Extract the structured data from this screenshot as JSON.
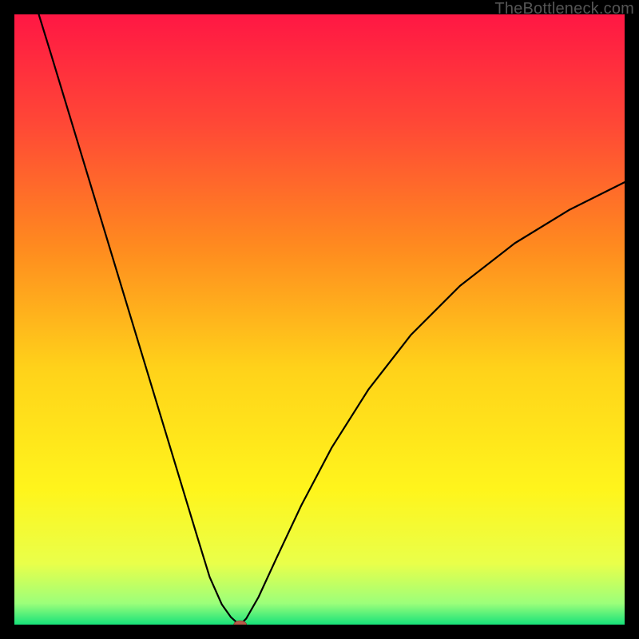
{
  "watermark": "TheBottleneck.com",
  "chart_data": {
    "type": "line",
    "title": "",
    "xlabel": "",
    "ylabel": "",
    "xlim": [
      0,
      100
    ],
    "ylim": [
      0,
      100
    ],
    "grid": false,
    "legend": false,
    "background_gradient": {
      "stops": [
        {
          "offset": 0.0,
          "color": "#ff1744"
        },
        {
          "offset": 0.18,
          "color": "#ff4836"
        },
        {
          "offset": 0.38,
          "color": "#ff8a1f"
        },
        {
          "offset": 0.58,
          "color": "#ffd21a"
        },
        {
          "offset": 0.78,
          "color": "#fff51c"
        },
        {
          "offset": 0.9,
          "color": "#e9ff4a"
        },
        {
          "offset": 0.965,
          "color": "#9cff7a"
        },
        {
          "offset": 1.0,
          "color": "#17e27a"
        }
      ]
    },
    "series": [
      {
        "name": "curve-left",
        "x": [
          4.0,
          6.0,
          9.0,
          12.0,
          15.0,
          18.0,
          21.0,
          24.0,
          27.0,
          30.0,
          32.0,
          34.0,
          35.5,
          36.5,
          37.0
        ],
        "y": [
          100.0,
          93.5,
          83.6,
          73.7,
          63.8,
          53.9,
          44.0,
          34.1,
          24.2,
          14.3,
          7.8,
          3.3,
          1.2,
          0.3,
          0.0
        ]
      },
      {
        "name": "curve-right",
        "x": [
          37.0,
          38.0,
          40.0,
          43.0,
          47.0,
          52.0,
          58.0,
          65.0,
          73.0,
          82.0,
          91.0,
          100.0
        ],
        "y": [
          0.0,
          1.0,
          4.5,
          11.0,
          19.5,
          29.0,
          38.5,
          47.5,
          55.5,
          62.5,
          68.0,
          72.5
        ]
      }
    ],
    "marker": {
      "name": "optimum-marker",
      "x": 37.0,
      "y": 0.0,
      "color": "#b85c4a",
      "rx": 8,
      "ry": 5
    }
  }
}
